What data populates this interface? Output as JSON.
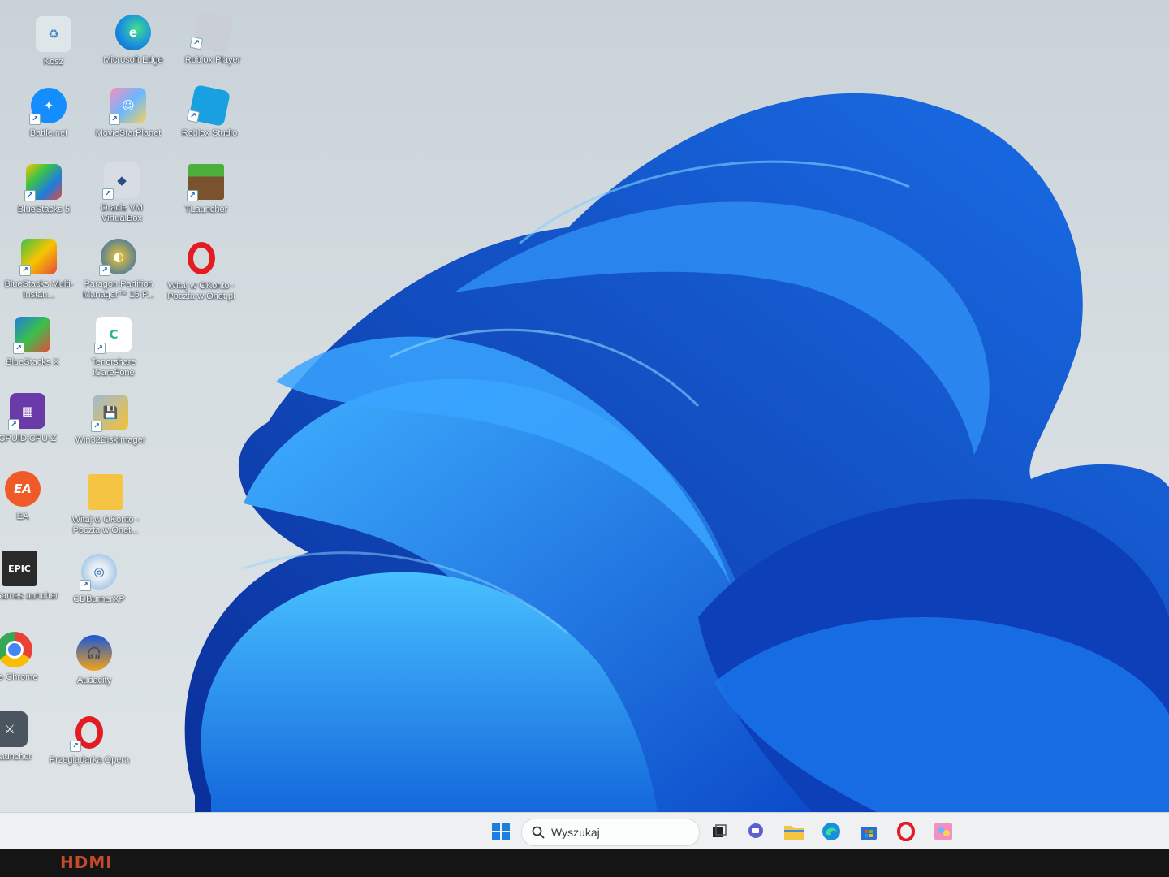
{
  "desktop": {
    "icons": [
      {
        "label": "Kosz",
        "icon": "recycle-bin-icon"
      },
      {
        "label": "Microsoft Edge",
        "icon": "edge-icon"
      },
      {
        "label": "Roblox Player",
        "icon": "roblox-player-icon"
      },
      {
        "label": "Battle.net",
        "icon": "battlenet-icon"
      },
      {
        "label": "MovieStarPlanet",
        "icon": "moviestarplanet-icon"
      },
      {
        "label": "Roblox Studio",
        "icon": "roblox-studio-icon"
      },
      {
        "label": "BlueStacks 5",
        "icon": "bluestacks-icon"
      },
      {
        "label": "Oracle VM VirtualBox",
        "icon": "virtualbox-icon"
      },
      {
        "label": "TLauncher",
        "icon": "tlauncher-icon"
      },
      {
        "label": "BlueStacks Multi-Instan...",
        "icon": "bluestacks-multi-icon"
      },
      {
        "label": "Paragon Partition Manager™ 15 P...",
        "icon": "paragon-icon"
      },
      {
        "label": "Witaj w OKonto - Poczta w Onet.pl",
        "icon": "opera-icon"
      },
      {
        "label": "BlueStacks X",
        "icon": "bluestacks-x-icon"
      },
      {
        "label": "Tenorshare iCareFone",
        "icon": "icarefone-icon"
      },
      {
        "label": "CPUID CPU-Z",
        "icon": "cpuz-icon"
      },
      {
        "label": "Win32DiskImager",
        "icon": "win32diskimager-icon"
      },
      {
        "label": "EA",
        "icon": "ea-icon"
      },
      {
        "label": "Witaj w OKonto - Poczta w Onet...",
        "icon": "folder-icon"
      },
      {
        "label": "pic Games auncher",
        "icon": "epic-games-icon"
      },
      {
        "label": "CDBurnerXP",
        "icon": "cdburnerxp-icon"
      },
      {
        "label": "gle Chrome",
        "icon": "chrome-icon"
      },
      {
        "label": "Audacity",
        "icon": "audacity-icon"
      },
      {
        "label": "s Launcher",
        "icon": "launcher-icon"
      },
      {
        "label": "Przeglądarka Opera",
        "icon": "opera-icon"
      }
    ]
  },
  "taskbar": {
    "search_placeholder": "Wyszukaj",
    "items": [
      "start-icon",
      "task-view-icon",
      "chat-icon",
      "file-explorer-icon",
      "edge-icon",
      "store-icon",
      "opera-icon",
      "moviestarplanet-icon"
    ]
  },
  "monitor": {
    "brand_label": "HDMI"
  },
  "colors": {
    "wallpaper_blue": "#1f7fe0",
    "taskbar_bg": "#eef0f2"
  }
}
